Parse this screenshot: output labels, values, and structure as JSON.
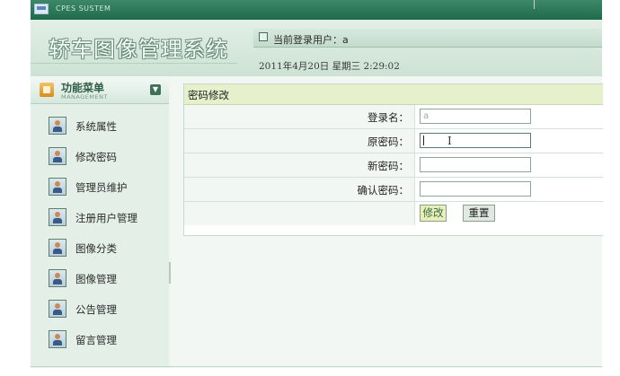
{
  "window": {
    "system_name": "CPES SUSTEM"
  },
  "header": {
    "app_title": "轿车图像管理系统",
    "current_user_label": "当前登录用户：a",
    "datetime": "2011年4月20日 星期三 2:29:02"
  },
  "sidebar": {
    "menu_title": "功能菜单",
    "menu_subtitle": "MANAGEMENT",
    "items": [
      {
        "label": "系统属性"
      },
      {
        "label": "修改密码"
      },
      {
        "label": "管理员维护"
      },
      {
        "label": "注册用户管理"
      },
      {
        "label": "图像分类"
      },
      {
        "label": "图像管理"
      },
      {
        "label": "公告管理"
      },
      {
        "label": "留言管理"
      }
    ]
  },
  "form": {
    "title": "密码修改",
    "login_name_label": "登录名：",
    "login_name_value": "a",
    "old_password_label": "原密码：",
    "new_password_label": "新密码：",
    "confirm_password_label": "确认密码：",
    "submit_label": "修改",
    "reset_label": "重置"
  },
  "colors": {
    "header_green": "#2d7a5a",
    "panel_header": "#e6f0cb",
    "sidebar_bg": "#e4efe8"
  }
}
